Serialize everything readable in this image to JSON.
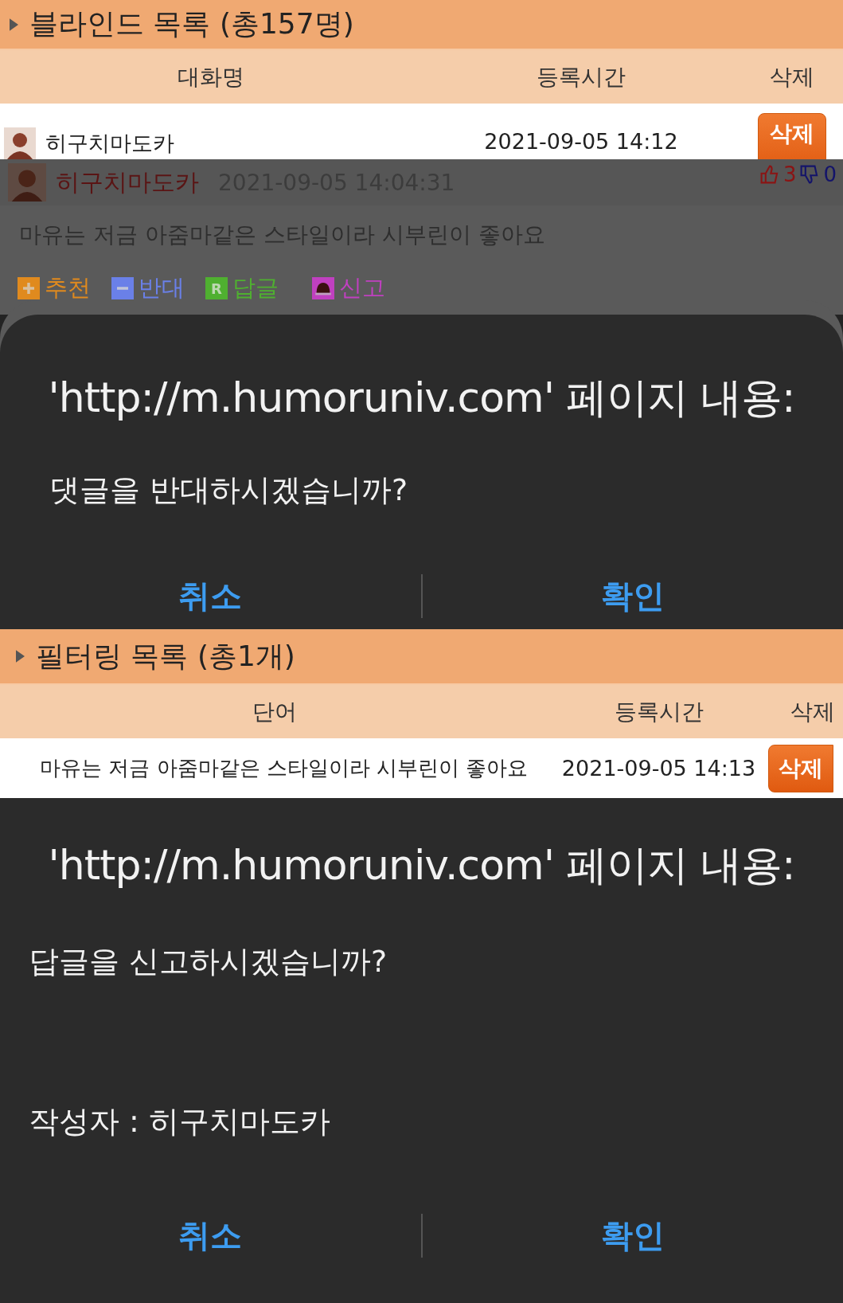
{
  "blind_list": {
    "title": "블라인드 목록 (총157명)",
    "columns": [
      "대화명",
      "등록시간",
      "삭제"
    ],
    "rows": [
      {
        "name": "히구치마도카",
        "time": "2021-09-05 14:12",
        "delete": "삭제"
      }
    ]
  },
  "comment": {
    "author": "히구치마도카",
    "time": "2021-09-05 14:04:31",
    "likes": "3",
    "dislikes": "0",
    "text": "마유는 저금 아줌마같은 스타일이라 시부린이 좋아요",
    "actions": [
      {
        "kind": "plus",
        "label": "추천",
        "color": "#e08a1e"
      },
      {
        "kind": "minus",
        "label": "반대",
        "color": "#6a80e8"
      },
      {
        "kind": "reply",
        "label": "답글",
        "color": "#4fb030",
        "icon_text": "R"
      },
      {
        "kind": "report",
        "label": "신고",
        "color": "#c040c0"
      }
    ]
  },
  "dialog_1": {
    "title": "'http://m.humoruniv.com' 페이지 내용:",
    "message": "댓글을 반대하시겠습니까?",
    "buttons": [
      "취소",
      "확인"
    ]
  },
  "filter_list": {
    "title": "필터링 목록 (총1개)",
    "columns": [
      "단어",
      "등록시간",
      "삭제"
    ],
    "rows": [
      {
        "word": "마유는 저금 아줌마같은 스타일이라 시부린이 좋아요",
        "time": "2021-09-05 14:13",
        "delete": "삭제"
      }
    ]
  },
  "dialog_2": {
    "title": "'http://m.humoruniv.com' 페이지 내용:",
    "message": "답글을 신고하시겠습니까?",
    "author_line": "작성자 : 히구치마도카",
    "buttons": [
      "취소",
      "확인"
    ]
  }
}
